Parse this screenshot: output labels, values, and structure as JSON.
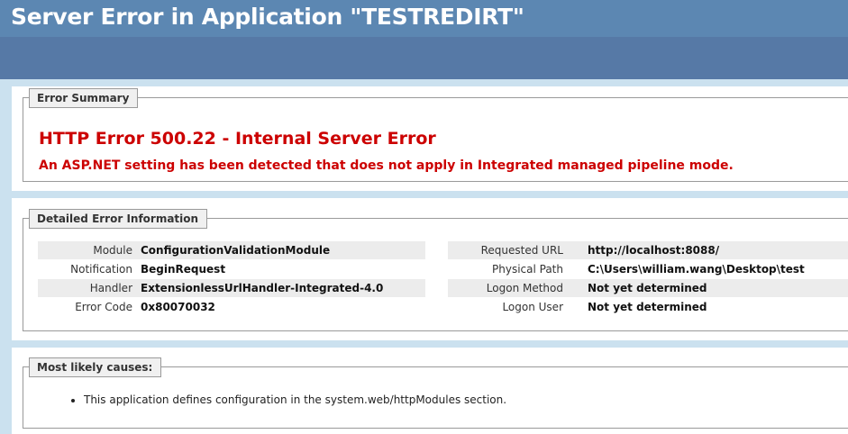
{
  "header": {
    "title": "Server Error in Application \"TESTREDIRT\""
  },
  "summary": {
    "legend": "Error Summary",
    "heading": "HTTP Error 500.22 - Internal Server Error",
    "message": "An ASP.NET setting has been detected that does not apply in Integrated managed pipeline mode."
  },
  "details": {
    "legend": "Detailed Error Information",
    "left": [
      {
        "label": "Module",
        "value": "ConfigurationValidationModule"
      },
      {
        "label": "Notification",
        "value": "BeginRequest"
      },
      {
        "label": "Handler",
        "value": "ExtensionlessUrlHandler-Integrated-4.0"
      },
      {
        "label": "Error Code",
        "value": "0x80070032"
      }
    ],
    "right": [
      {
        "label": "Requested URL",
        "value": "http://localhost:8088/"
      },
      {
        "label": "Physical Path",
        "value": "C:\\Users\\william.wang\\Desktop\\test"
      },
      {
        "label": "Logon Method",
        "value": "Not yet determined"
      },
      {
        "label": "Logon User",
        "value": "Not yet determined"
      }
    ]
  },
  "causes": {
    "legend": "Most likely causes:",
    "items": [
      "This application defines configuration in the system.web/httpModules section."
    ]
  }
}
